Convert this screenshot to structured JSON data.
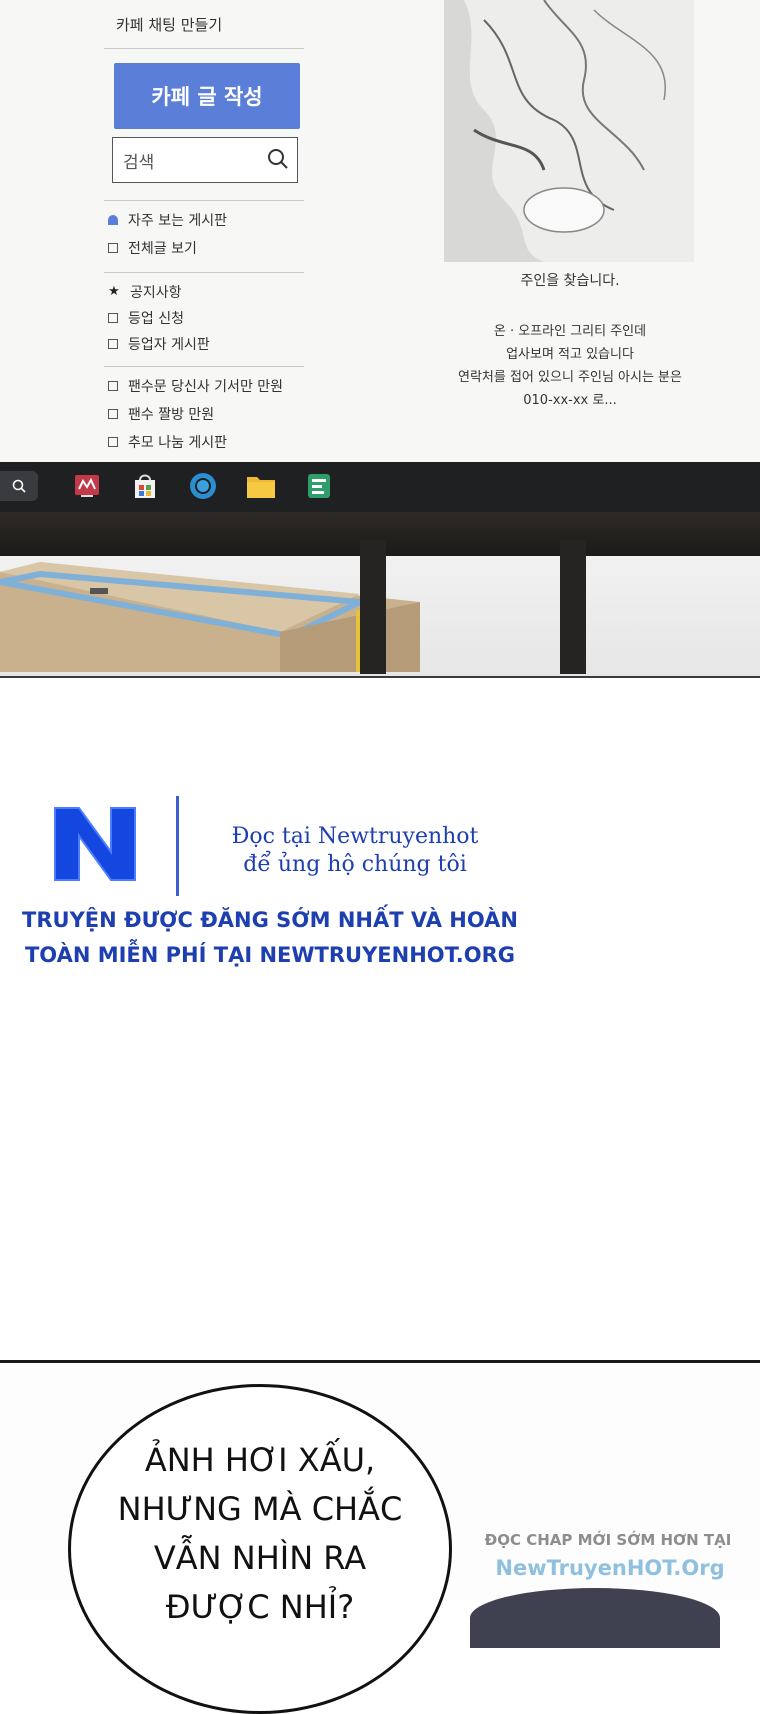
{
  "manga_panel": {
    "sidebar": {
      "top_label": "카페 채팅 만들기",
      "write_button": "카페 글 작성",
      "search_placeholder": "검색",
      "items_group1": [
        "자주 보는 게시판",
        "전체글 보기"
      ],
      "items_group2": [
        "공지사항",
        "등업 신청",
        "등업자 게시판"
      ],
      "items_group3": [
        "팬수문 당신사 기서만 만원",
        "팬수 짤방 만원",
        "추모 나눔 게시판"
      ]
    },
    "post": {
      "caption": "주인을 찾습니다.",
      "body_lines": [
        "온 · 오프라인 그리티 주인데",
        "업사보며 적고 있습니다",
        "연락처를 접어 있으니 주인님 아시는 분은",
        "010-xx-xx 로..."
      ]
    },
    "taskbar_icons": [
      "search-icon",
      "media-app-icon",
      "store-icon",
      "browser-icon",
      "folder-icon",
      "notes-app-icon"
    ]
  },
  "promo": {
    "logo_letter": "N",
    "line1": "Đọc tại Newtruyenhot",
    "line2": "để ủng hộ chúng tôi",
    "line3": "TRUYỆN ĐƯỢC ĐĂNG SỚM NHẤT VÀ HOÀN",
    "line4": "TOÀN MIỄN PHÍ TẠI NEWTRUYENHOT.ORG"
  },
  "speech_bubble": {
    "lines": [
      "ẢNH HƠI XẤU,",
      "NHƯNG MÀ CHẮC",
      "VẪN NHÌN RA",
      "ĐƯỢC NHỈ?"
    ]
  },
  "watermark": {
    "line1": "ĐỌC CHAP MỚI SỚM HƠN TẠI",
    "line2": "NewTruyenHOT.Org"
  },
  "colors": {
    "accent_blue": "#1d3fb0",
    "button_blue": "#5b7fd8",
    "taskbar": "#1f2022",
    "watermark_blue": "#8fc0e0"
  }
}
